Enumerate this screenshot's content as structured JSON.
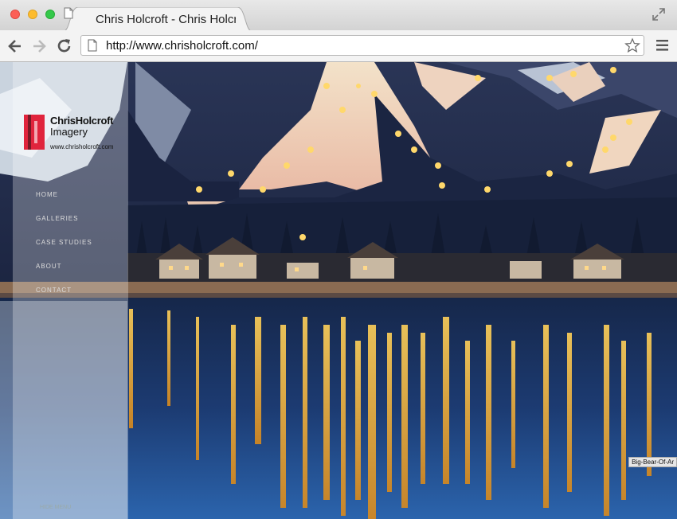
{
  "browser": {
    "tab_title": "Chris Holcroft - Chris Holcroft",
    "url": "http://www.chrisholcroft.com/"
  },
  "site": {
    "logo": {
      "name": "ChrisHolcroft",
      "sub": "Imagery",
      "url": "www.chrisholcroft.com"
    },
    "nav": [
      "HOME",
      "GALLERIES",
      "CASE STUDIES",
      "ABOUT",
      "CONTACT"
    ],
    "photo_caption": "Big-Bear-Of-Ar",
    "hide_menu": "HIDE MENU"
  },
  "colors": {
    "logo_red": "#e0243c",
    "tab_bar": "#d3d3d3"
  }
}
